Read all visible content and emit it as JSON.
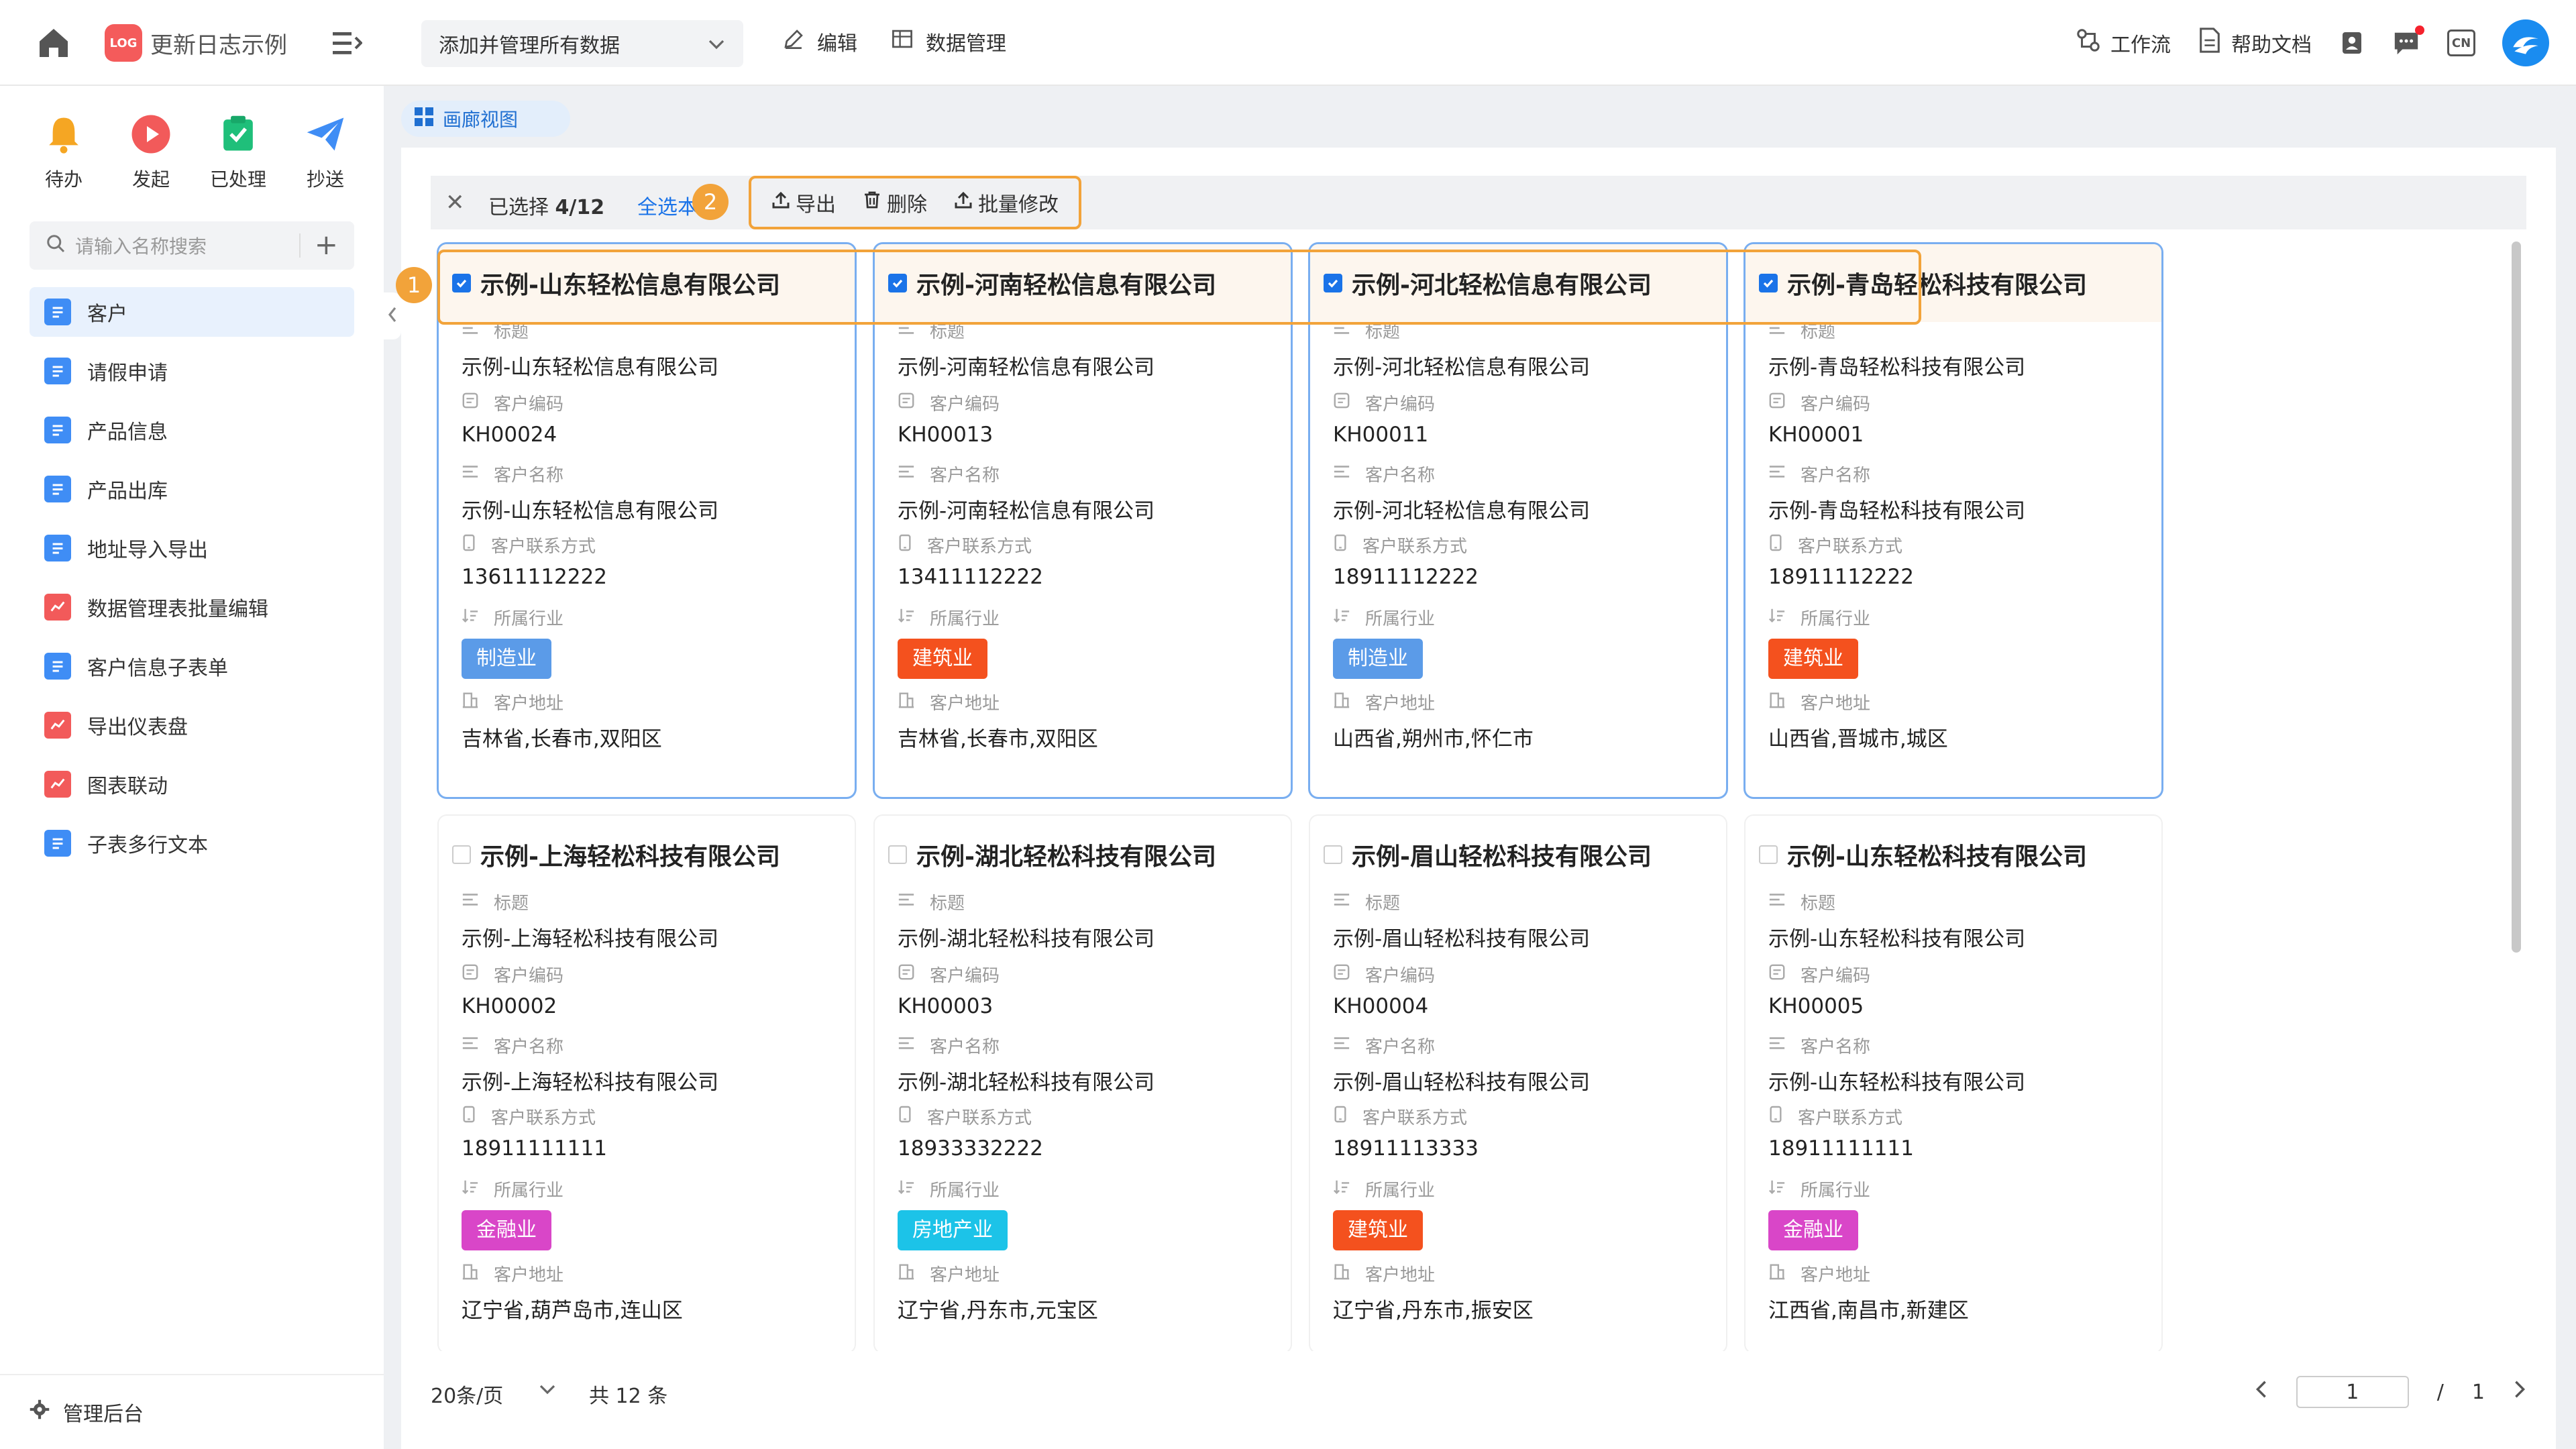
{
  "app": {
    "title": "更新日志示例",
    "logo_text": "LOG"
  },
  "topbar": {
    "view_select": "添加并管理所有数据",
    "edit_label": "编辑",
    "data_manage_label": "数据管理",
    "workflow_label": "工作流",
    "help_label": "帮助文档",
    "lang_label": "CN"
  },
  "sidebar": {
    "quick": [
      {
        "label": "待办",
        "icon": "bell-icon",
        "color": "#f5a623"
      },
      {
        "label": "发起",
        "icon": "play-icon",
        "color": "#f25a5a"
      },
      {
        "label": "已处理",
        "icon": "check-doc-icon",
        "color": "#1fbf7a"
      },
      {
        "label": "抄送",
        "icon": "send-icon",
        "color": "#3f8df5"
      }
    ],
    "search_placeholder": "请输入名称搜索",
    "items": [
      {
        "label": "客户",
        "color": "#3f8df5"
      },
      {
        "label": "请假申请",
        "color": "#3f8df5"
      },
      {
        "label": "产品信息",
        "color": "#3f8df5"
      },
      {
        "label": "产品出库",
        "color": "#3f8df5"
      },
      {
        "label": "地址导入导出",
        "color": "#3f8df5"
      },
      {
        "label": "数据管理表批量编辑",
        "color": "#f25a5a"
      },
      {
        "label": "客户信息子表单",
        "color": "#3f8df5"
      },
      {
        "label": "导出仪表盘",
        "color": "#f25a5a"
      },
      {
        "label": "图表联动",
        "color": "#f25a5a"
      },
      {
        "label": "子表多行文本",
        "color": "#3f8df5"
      }
    ],
    "admin_label": "管理后台"
  },
  "view_tab": "画廊视图",
  "selection": {
    "selected_label": "已选择",
    "count": "4/12",
    "select_all": "全选本",
    "export": "导出",
    "delete": "删除",
    "batch_edit": "批量修改",
    "badge1": "1",
    "badge2": "2"
  },
  "field_labels": {
    "title": "标题",
    "code": "客户编码",
    "name": "客户名称",
    "contact": "客户联系方式",
    "industry": "所属行业",
    "address": "客户地址"
  },
  "industry_colors": {
    "制造业": "#5b9be8",
    "建筑业": "#f4511e",
    "金融业": "#d946c8",
    "房地产业": "#1cc3e8"
  },
  "cards": [
    {
      "name": "示例-山东轻松信息有限公司",
      "code": "KH00024",
      "contact": "13611112222",
      "industry": "制造业",
      "address": "吉林省,长春市,双阳区",
      "selected": true
    },
    {
      "name": "示例-河南轻松信息有限公司",
      "code": "KH00013",
      "contact": "13411112222",
      "industry": "建筑业",
      "address": "吉林省,长春市,双阳区",
      "selected": true
    },
    {
      "name": "示例-河北轻松信息有限公司",
      "code": "KH00011",
      "contact": "18911112222",
      "industry": "制造业",
      "address": "山西省,朔州市,怀仁市",
      "selected": true
    },
    {
      "name": "示例-青岛轻松科技有限公司",
      "code": "KH00001",
      "contact": "18911112222",
      "industry": "建筑业",
      "address": "山西省,晋城市,城区",
      "selected": true
    },
    {
      "name": "示例-上海轻松科技有限公司",
      "code": "KH00002",
      "contact": "18911111111",
      "industry": "金融业",
      "address": "辽宁省,葫芦岛市,连山区",
      "selected": false
    },
    {
      "name": "示例-湖北轻松科技有限公司",
      "code": "KH00003",
      "contact": "18933332222",
      "industry": "房地产业",
      "address": "辽宁省,丹东市,元宝区",
      "selected": false
    },
    {
      "name": "示例-眉山轻松科技有限公司",
      "code": "KH00004",
      "contact": "18911113333",
      "industry": "建筑业",
      "address": "辽宁省,丹东市,振安区",
      "selected": false
    },
    {
      "name": "示例-山东轻松科技有限公司",
      "code": "KH00005",
      "contact": "18911111111",
      "industry": "金融业",
      "address": "江西省,南昌市,新建区",
      "selected": false
    }
  ],
  "pager": {
    "page_size": "20条/页",
    "total": "共 12 条",
    "current_page": "1",
    "separator": "/",
    "total_pages": "1"
  }
}
